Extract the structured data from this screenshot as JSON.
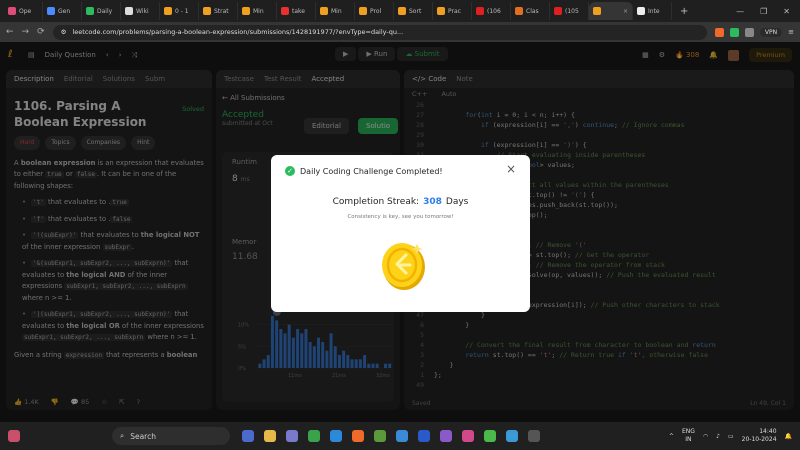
{
  "browser": {
    "tabs": [
      {
        "label": "Ope",
        "color": "#e04c7a"
      },
      {
        "label": "Gen",
        "color": "#4a8cff"
      },
      {
        "label": "Daily",
        "color": "#2cbb5d"
      },
      {
        "label": "Wiki",
        "color": "#dddddd"
      },
      {
        "label": "0 - 1",
        "color": "#f0a020"
      },
      {
        "label": "Strat",
        "color": "#f0a020"
      },
      {
        "label": "Min",
        "color": "#f0a020"
      },
      {
        "label": "take",
        "color": "#e83030"
      },
      {
        "label": "Min",
        "color": "#f0a020"
      },
      {
        "label": "Prol",
        "color": "#f0a020"
      },
      {
        "label": "Sort",
        "color": "#f0a020"
      },
      {
        "label": "Prac",
        "color": "#f0a020"
      },
      {
        "label": "(106",
        "color": "#e02020"
      },
      {
        "label": "Clas",
        "color": "#e07020"
      },
      {
        "label": "(105",
        "color": "#e02020"
      },
      {
        "label": "",
        "color": "#f0a020",
        "active": true
      },
      {
        "label": "Inte",
        "color": "#eeeeee"
      }
    ],
    "new_tab": "+",
    "url": "leetcode.com/problems/parsing-a-boolean-expression/submissions/1428191977/?envType=daily-qu...",
    "vpn": "VPN"
  },
  "header": {
    "daily_question": "Daily Question",
    "run": "Run",
    "submit": "Submit",
    "streak": "308",
    "premium": "Premium"
  },
  "left": {
    "tabs": [
      "Description",
      "Editorial",
      "Solutions",
      "Subm"
    ],
    "title": "1106. Parsing A Boolean Expression",
    "solved": "Solved",
    "chips": [
      "Hard",
      "Topics",
      "Companies",
      "Hint"
    ],
    "intro_a": "A ",
    "intro_b": "boolean expression",
    "intro_c": " is an expression that evaluates to either ",
    "intro_true": "true",
    "intro_or": " or ",
    "intro_false": "false",
    "intro_d": ". It can be in one of the following shapes:",
    "bullets": [
      {
        "code": "'t'",
        "text": " that evaluates to ",
        "code2": "true",
        "end": "."
      },
      {
        "code": "'f'",
        "text": " that evaluates to ",
        "code2": "false",
        "end": "."
      },
      {
        "code": "'!(subExpr)'",
        "text": " that evaluates to ",
        "bold": "the logical NOT",
        "end": " of the inner expression ",
        "code2": "subExpr",
        "end2": "."
      },
      {
        "code": "'&(subExpr1, subExpr2, ..., subExprn)'",
        "text": " that evaluates to ",
        "bold": "the logical AND",
        "end": " of the inner expressions ",
        "code2": "subExpr1, subExpr2, ..., subExprn",
        "end2": " where n >= 1."
      },
      {
        "code": "'|(subExpr1, subExpr2, ..., subExprn)'",
        "text": " that evaluates to ",
        "bold": "the logical OR",
        "end": " of the inner expressions ",
        "code2": "subExpr1, subExpr2, ..., subExprn",
        "end2": " where n >= 1."
      }
    ],
    "given": "Given a string ",
    "given_code": "expression",
    "given_end": " that represents a ",
    "given_bold": "boolean",
    "likes": "1.4K",
    "comments": "85"
  },
  "mid": {
    "tabs": [
      "Testcase",
      "Test Result",
      "Accepted"
    ],
    "all_submissions": "All Submissions",
    "status": "Accepted",
    "submitted": "submitted at Oct",
    "editorial": "Editorial",
    "solution": "Solutio",
    "runtime": "Runtim",
    "runtime_val": "8",
    "runtime_unit": "ms",
    "memory": "Memor",
    "memory_val": "11.68",
    "y_ticks": [
      "10%",
      "5%",
      "0%"
    ],
    "x_ticks": [
      "11ms",
      "21ms",
      "32ms"
    ]
  },
  "right": {
    "tabs": [
      "Code",
      "Note"
    ],
    "lang": "C++",
    "auto": "Auto",
    "saved": "Saved",
    "cursor": "Ln 49, Col 1",
    "lines": [
      {
        "n": "26",
        "t": ""
      },
      {
        "n": "27",
        "t": "        for(int i = 0; i < n; i++) {"
      },
      {
        "n": "28",
        "t": "            if (expression[i] == ',') continue; // Ignore commas"
      },
      {
        "n": "29",
        "t": ""
      },
      {
        "n": "30",
        "t": "            if (expression[i] == ')') {"
      },
      {
        "n": "31",
        "t": "                // Start evaluating inside parentheses"
      },
      {
        "n": "32",
        "t": "                vector<bool> values;"
      },
      {
        "n": "33",
        "t": ""
      },
      {
        "n": "34",
        "t": "                // Collect all values within the parentheses"
      },
      {
        "n": "35",
        "t": "                while (st.top() != '(') {"
      },
      {
        "n": "36",
        "t": "                    values.push_back(st.top());"
      },
      {
        "n": "37",
        "t": "                    st.pop();"
      },
      {
        "n": "38",
        "t": "                }"
      },
      {
        "n": "39",
        "t": ""
      },
      {
        "n": "40",
        "t": "                st.pop(); // Remove '('"
      },
      {
        "n": "41",
        "t": "                char op = st.top(); // Get the operator"
      },
      {
        "n": "42",
        "t": "                st.pop(); // Remove the operator from stack"
      },
      {
        "n": "43",
        "t": "                st.push(solve(op, values)); // Push the evaluated result"
      },
      {
        "n": "44",
        "t": "            } else {"
      },
      {
        "n": "45",
        "t": ""
      },
      {
        "n": "46",
        "t": "                st.push(expression[i]); // Push other characters to stack"
      },
      {
        "n": "47",
        "t": "            }"
      },
      {
        "n": "6",
        "t": "        }"
      },
      {
        "n": "5",
        "t": ""
      },
      {
        "n": "4",
        "t": "        // Convert the final result from character to boolean and return"
      },
      {
        "n": "3",
        "t": "        return st.top() == 't'; // Return true if 't', otherwise false"
      },
      {
        "n": "2",
        "t": "    }"
      },
      {
        "n": "1",
        "t": "};"
      },
      {
        "n": "49",
        "t": ""
      }
    ]
  },
  "modal": {
    "title": "Daily Coding Challenge Completed!",
    "streak_label": "Completion Streak:",
    "streak_num": "308",
    "streak_unit": "Days",
    "subtitle": "Consistency is key, see you tomorrow!"
  },
  "taskbar": {
    "search": "Search",
    "lang": "ENG",
    "region": "IN",
    "time": "14:40",
    "date": "20-10-2024"
  },
  "chart_data": {
    "type": "bar",
    "values": [
      1,
      2,
      3,
      12,
      11,
      9,
      8,
      10,
      7,
      9,
      8,
      9,
      6,
      5,
      7,
      6,
      4,
      8,
      5,
      3,
      4,
      3,
      2,
      2,
      2,
      3,
      1,
      1,
      1,
      0,
      1,
      1
    ],
    "ylim": [
      0,
      12
    ]
  }
}
